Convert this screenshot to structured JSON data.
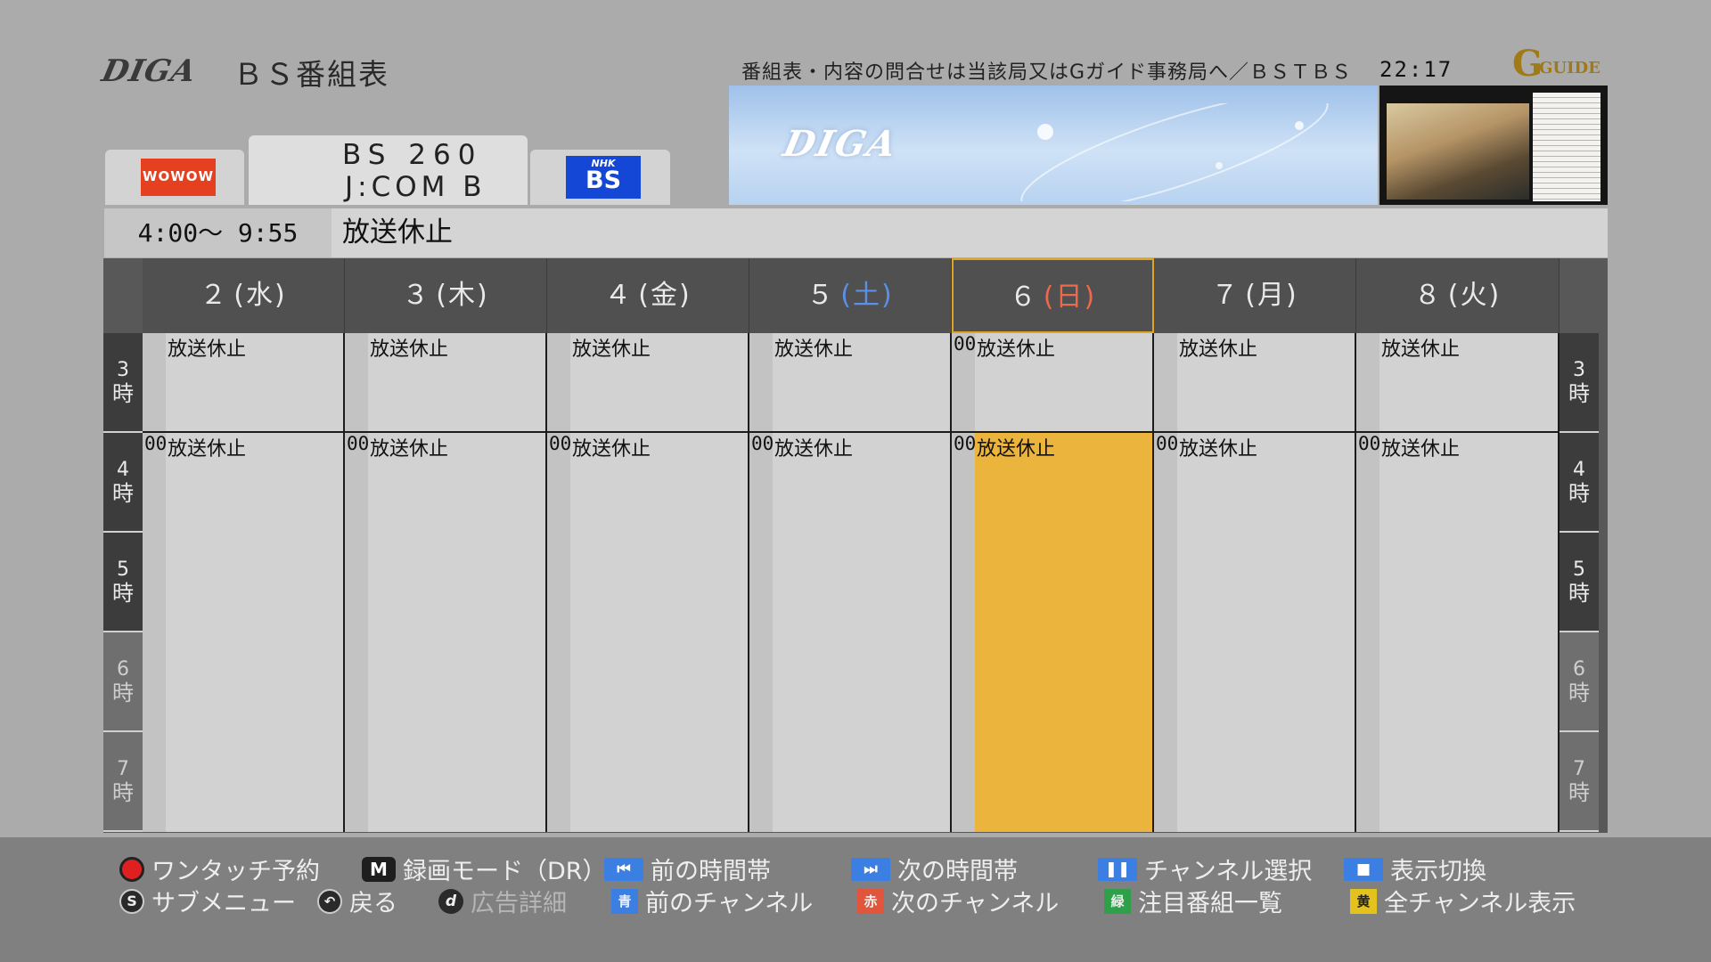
{
  "header": {
    "logo": "DIGA",
    "title": "ＢＳ番組表",
    "notice": "番組表・内容の問合せは当該局又はGガイド事務局へ／ＢＳＴＢＳ",
    "clock": "22:17",
    "gguide_logo": "GUIDE"
  },
  "banner": {
    "logo": "DIGA"
  },
  "channels": {
    "left_logo": "WOWOW",
    "center_line1": "BS 260",
    "center_line2": "J:COM B",
    "right_logo_small": "NHK",
    "right_logo_big": "BS"
  },
  "selected_program": {
    "time": "4:00～ 9:55",
    "title": "放送休止"
  },
  "days": [
    {
      "day": "２",
      "dow": "(水)",
      "color": "normal"
    },
    {
      "day": "３",
      "dow": "(木)",
      "color": "normal"
    },
    {
      "day": "４",
      "dow": "(金)",
      "color": "normal"
    },
    {
      "day": "５",
      "dow": "(土)",
      "color": "blue"
    },
    {
      "day": "６",
      "dow": "(日)",
      "color": "red"
    },
    {
      "day": "７",
      "dow": "(月)",
      "color": "normal"
    },
    {
      "day": "８",
      "dow": "(火)",
      "color": "normal"
    }
  ],
  "hours": [
    {
      "num": "3",
      "unit": "時"
    },
    {
      "num": "4",
      "unit": "時"
    },
    {
      "num": "5",
      "unit": "時"
    },
    {
      "num": "6",
      "unit": "時"
    },
    {
      "num": "7",
      "unit": "時"
    }
  ],
  "programs": {
    "row1_title": "放送休止",
    "row2_min": "00",
    "row2_title": "放送休止",
    "sunday_row1_min": "00"
  },
  "footer": {
    "one_touch": "ワンタッチ予約",
    "rec_mode": "録画モード（DR）",
    "prev_time": "前の時間帯",
    "next_time": "次の時間帯",
    "channel_select": "チャンネル選択",
    "display_switch": "表示切換",
    "submenu": "サブメニュー",
    "back": "戻る",
    "ad_detail": "広告詳細",
    "prev_channel": "前のチャンネル",
    "next_channel": "次のチャンネル",
    "featured": "注目番組一覧",
    "all_channels": "全チャンネル表示",
    "key_blue": "青",
    "key_red": "赤",
    "key_green": "緑",
    "key_yellow": "黄",
    "key_m": "M",
    "key_s": "S",
    "key_d": "d"
  },
  "colors": {
    "selected_cell": "#ebb43c",
    "selected_border": "#e1a322",
    "saturday": "#5c8fe6",
    "sunday": "#ec6a4c"
  }
}
